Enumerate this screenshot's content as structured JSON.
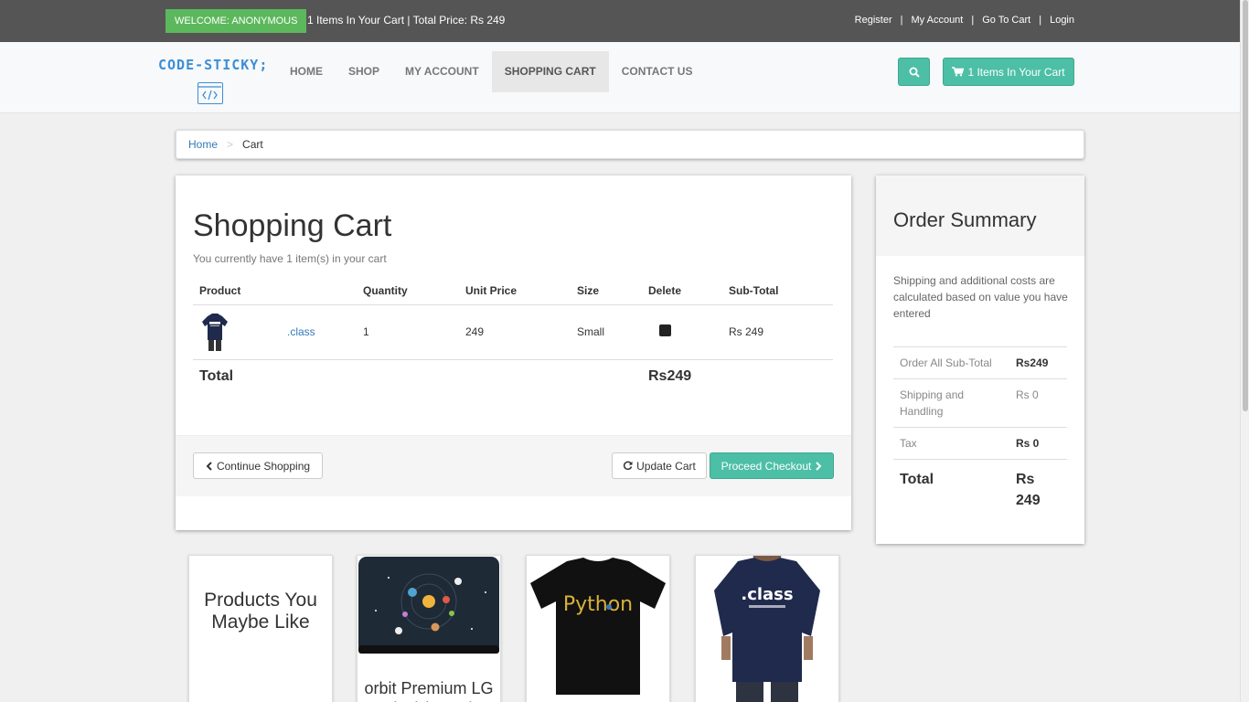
{
  "topbar": {
    "welcome": "WELCOME: ANONYMOUS",
    "cart_summary": "1 Items In Your Cart | Total Price: Rs 249",
    "links": [
      "Register",
      "My Account",
      "Go To Cart",
      "Login"
    ]
  },
  "logo": {
    "text": "CODE-STICKY;"
  },
  "nav": {
    "items": [
      "HOME",
      "SHOP",
      "MY ACCOUNT",
      "SHOPPING CART",
      "CONTACT US"
    ],
    "active": "SHOPPING CART",
    "cart_button": "1 Items In Your Cart"
  },
  "breadcrumb": {
    "home": "Home",
    "separator": ">",
    "current": "Cart"
  },
  "cart": {
    "title": "Shopping Cart",
    "subtitle": "You currently have 1 item(s) in your cart",
    "headers": [
      "Product",
      "Quantity",
      "Unit Price",
      "Size",
      "Delete",
      "Sub-Total"
    ],
    "rows": [
      {
        "product": ".class",
        "quantity": "1",
        "unit_price": "249",
        "size": "Small",
        "subtotal": "Rs 249"
      }
    ],
    "total_label": "Total",
    "total_value": "Rs249",
    "continue_label": "Continue Shopping",
    "update_label": "Update Cart",
    "checkout_label": "Proceed Checkout"
  },
  "summary": {
    "title": "Order Summary",
    "note": "Shipping and additional costs are calculated based on value you have entered",
    "rows": [
      {
        "label": "Order All Sub-Total",
        "value": "Rs249"
      },
      {
        "label": "Shipping and Handling",
        "value": "Rs 0"
      },
      {
        "label": "Tax",
        "value": "Rs 0"
      }
    ],
    "total_label": "Total",
    "total_value": "Rs 249"
  },
  "products": {
    "heading": "Products You Maybe Like",
    "items": [
      {
        "name": "orbit Premium LG Vinyl (matte)"
      },
      {
        "name": ""
      },
      {
        "name": ""
      }
    ]
  },
  "colors": {
    "accent": "#4cbfa6",
    "welcome": "#5cb85c",
    "topbar": "#555555",
    "link": "#337ab7"
  }
}
